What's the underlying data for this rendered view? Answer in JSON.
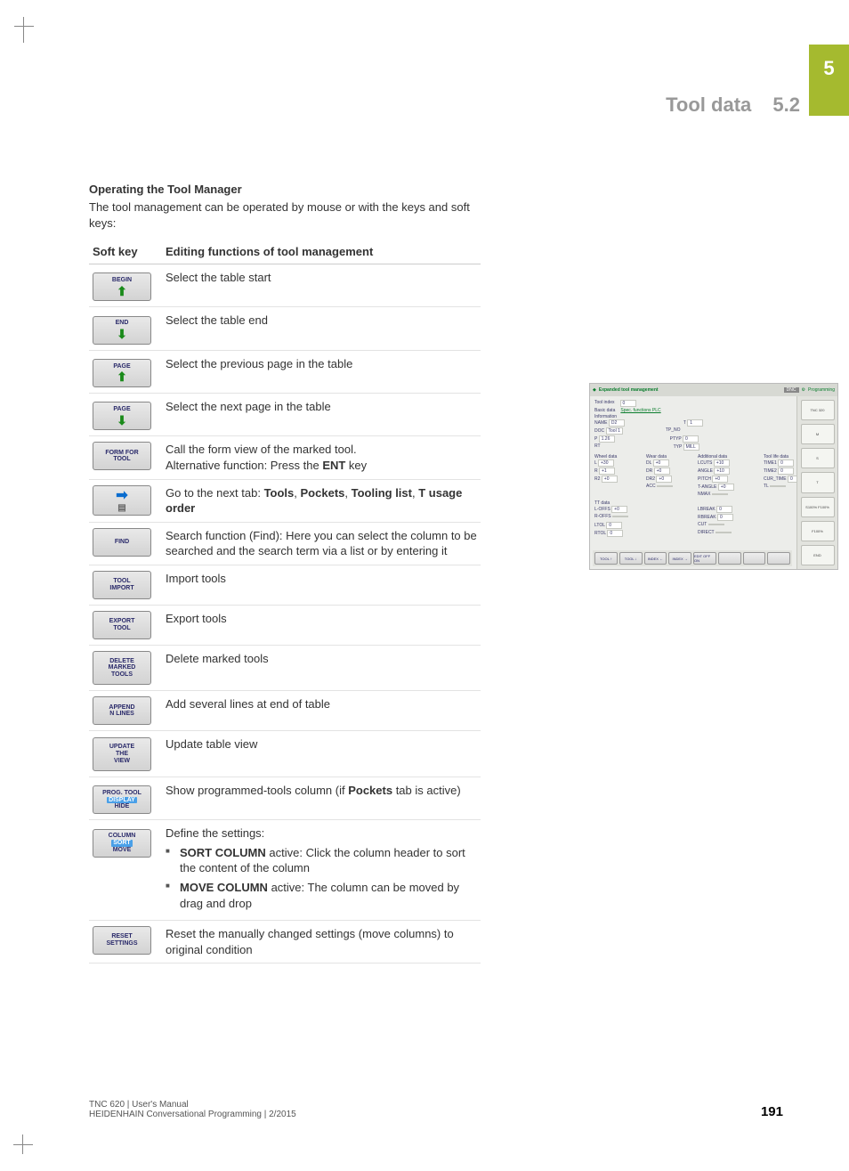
{
  "chapter_number": "5",
  "section_title": "Tool data",
  "section_number": "5.2",
  "heading": "Operating the Tool Manager",
  "intro": "The tool management can be operated by mouse or with the keys and soft keys:",
  "table": {
    "col1": "Soft key",
    "col2": "Editing functions of tool management",
    "rows": [
      {
        "key_label": "BEGIN",
        "icon": "up",
        "desc": "Select the table start"
      },
      {
        "key_label": "END",
        "icon": "down",
        "desc": "Select the table end"
      },
      {
        "key_label": "PAGE",
        "icon": "up",
        "desc": "Select the previous page in the table"
      },
      {
        "key_label": "PAGE",
        "icon": "down",
        "desc": "Select the next page in the table"
      },
      {
        "key_label": "FORM FOR\nTOOL",
        "desc_html": "Call the form view of the marked tool.<br>Alternative function: Press the <b>ENT</b> key"
      },
      {
        "key_icon_only": "right",
        "desc_html": "Go to the next tab: <b>Tools</b>, <b>Pockets</b>, <b>Tooling list</b>, <b>T usage order</b>"
      },
      {
        "key_label": "FIND",
        "desc": "Search function (Find): Here you can select the column to be searched and the search term via a list or by entering it"
      },
      {
        "key_label": "TOOL\nIMPORT",
        "desc": "Import tools"
      },
      {
        "key_label": "EXPORT\nTOOL",
        "desc": "Export tools"
      },
      {
        "key_label": "DELETE\nMARKED\nTOOLS",
        "desc": "Delete marked tools"
      },
      {
        "key_label": "APPEND\nN LINES",
        "desc": "Add several lines at end of table"
      },
      {
        "key_label": "UPDATE\nTHE\nVIEW",
        "desc": "Update table view"
      },
      {
        "key_label": "PROG. TOOL",
        "key_label2_hl": "DISPLAY",
        "key_label3": "HIDE",
        "desc_html": "Show programmed-tools column (if <b>Pockets</b> tab is active)"
      },
      {
        "key_label": "COLUMN",
        "key_label2_hl": "SORT",
        "key_label3": "MOVE",
        "desc_pre": "Define the settings:",
        "bullets": [
          {
            "b": "SORT COLUMN",
            "rest": " active: Click the column header to sort the content of the column"
          },
          {
            "b": "MOVE COLUMN",
            "rest": " active: The column can be moved by drag and drop"
          }
        ]
      },
      {
        "key_label": "RESET\nSETTINGS",
        "desc": "Reset the manually changed settings (move columns) to original condition"
      }
    ]
  },
  "figure": {
    "title_left": "Expanded tool management",
    "title_dnc": "DNC",
    "title_prog": "Programming",
    "device_label": "TNC 320",
    "tool_index_label": "Tool index",
    "tool_index_val": "0",
    "tabs_line_pre": "Basic data ",
    "tabs_line_underline": "Spec. functions PLC",
    "info_hdr": "Information",
    "info": {
      "name_l": "NAME",
      "name_v": "D2",
      "t_l": "T",
      "t_v": "1",
      "doc_l": "DOC",
      "doc_v": "Tool 1",
      "tpno_l": "TP_NO",
      "p_l": "P",
      "p_v": "1.26",
      "ptyp_l": "PTYP",
      "ptyp_v": "0",
      "rt_l": "RT",
      "typ_l": "TYP",
      "typ_v": "MILL"
    },
    "groups": {
      "g1": "Wheel data",
      "g2": "Wear data",
      "g3": "Additional data",
      "g4": "Tool life data"
    },
    "col1": [
      {
        "l": "L",
        "v": "+30"
      },
      {
        "l": "R",
        "v": "+1"
      },
      {
        "l": "R2",
        "v": "+0"
      }
    ],
    "col2": [
      {
        "l": "DL",
        "v": "+0"
      },
      {
        "l": "DR",
        "v": "+0"
      },
      {
        "l": "DR2",
        "v": "+0"
      },
      {
        "l": "ACC",
        "v": ""
      }
    ],
    "col3": [
      {
        "l": "LCUTS",
        "v": "+10"
      },
      {
        "l": "ANGLE",
        "v": "+10"
      },
      {
        "l": "PITCH",
        "v": "+0"
      },
      {
        "l": "T-ANGLE",
        "v": "+0"
      },
      {
        "l": "NMAX",
        "v": ""
      }
    ],
    "col4": [
      {
        "l": "TIME1",
        "v": "0"
      },
      {
        "l": "TIME2",
        "v": "0"
      },
      {
        "l": "CUR_TIME",
        "v": "0"
      },
      {
        "l": "TL",
        "v": ""
      }
    ],
    "tt_hdr": "TT data",
    "tt_left": [
      {
        "l": "L-OFFS",
        "v": "+0"
      },
      {
        "l": "R-OFFS",
        "v": ""
      },
      {
        "l": "LTOL",
        "v": "0"
      },
      {
        "l": "RTOL",
        "v": "0"
      }
    ],
    "tt_right": [
      {
        "l": "LBREAK",
        "v": "0"
      },
      {
        "l": "RBREAK",
        "v": "0"
      },
      {
        "l": "CUT",
        "v": ""
      },
      {
        "l": "DIRECT",
        "v": ""
      }
    ],
    "bottom_buttons": [
      "TOOL ↑",
      "TOOL ↓",
      "INDEX ←",
      "INDEX →",
      "EDIT OFF ON",
      "",
      "",
      ""
    ],
    "right_panels": [
      "M",
      "S",
      "T",
      "S100% F100%",
      "F100%",
      "END"
    ]
  },
  "footer": {
    "line1": "TNC 620 | User's Manual",
    "line2": "HEIDENHAIN Conversational Programming | 2/2015",
    "page": "191"
  }
}
